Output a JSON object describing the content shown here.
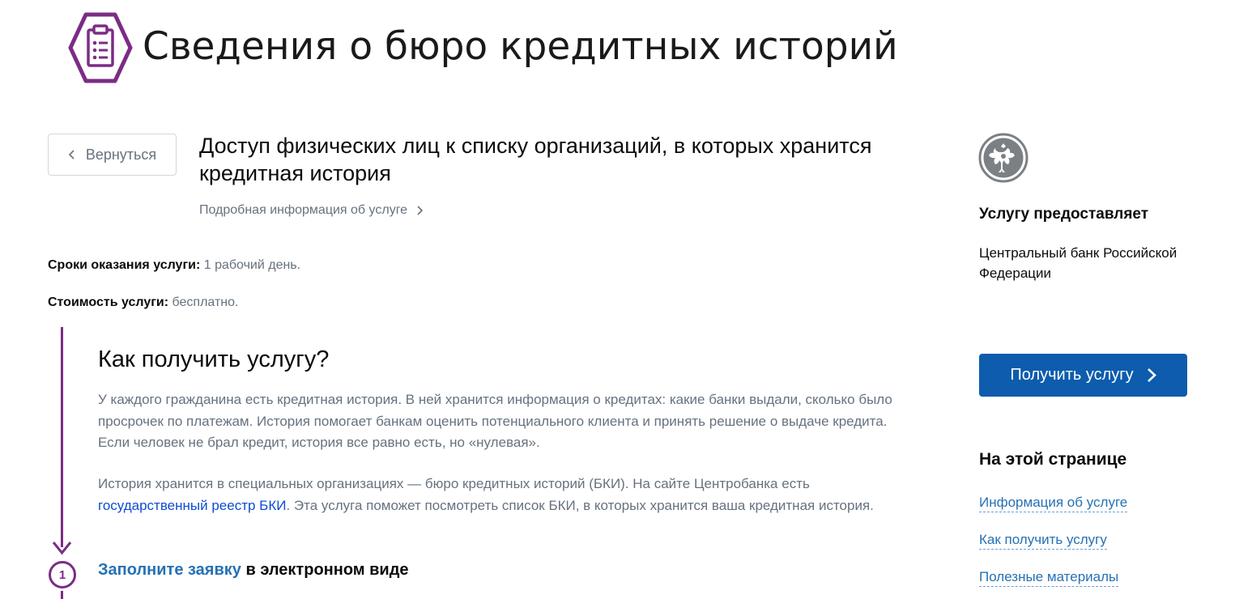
{
  "header": {
    "title": "Сведения о бюро кредитных историй",
    "icon": "clipboard-list-icon",
    "accent_color": "#7b2c85"
  },
  "back_button": {
    "label": "Вернуться",
    "icon": "chevron-left-icon"
  },
  "service": {
    "title": "Доступ физических лиц к списку организаций, в которых хранится кредитная история",
    "details_link": "Подробная информация об услуге"
  },
  "meta": {
    "term_label": "Сроки оказания услуги:",
    "term_value": "1 рабочий день.",
    "cost_label": "Стоимость услуги:",
    "cost_value": "бесплатно."
  },
  "how_to": {
    "heading": "Как получить услугу?",
    "paragraph1": "У каждого гражданина есть кредитная история. В ней хранится информация о кредитах: какие банки выдали, сколько было просрочек по платежам. История помогает банкам оценить потенциального клиента и принять решение о выдаче кредита. Если человек не брал кредит, история все равно есть, но «нулевая».",
    "paragraph2_before": "История хранится в специальных организациях — бюро кредитных историй (БКИ). На сайте Центробанка есть ",
    "paragraph2_link": "государственный реестр БКИ",
    "paragraph2_after": ". Эта услуга поможет посмотреть список БКИ, в которых хранится ваша кредитная история."
  },
  "steps": [
    {
      "number": "1",
      "link_text": "Заполните заявку",
      "rest_text": " в электронном виде"
    }
  ],
  "sidebar": {
    "emblem": "bank-of-russia-emblem-icon",
    "provider_heading": "Услугу предоставляет",
    "provider_name": "Центральный банк Российской Федерации",
    "primary_button": "Получить услугу",
    "primary_color": "#0d5cad",
    "toc_heading": "На этой странице",
    "toc_links": [
      "Информация об услуге",
      "Как получить услугу",
      "Полезные материалы"
    ]
  }
}
